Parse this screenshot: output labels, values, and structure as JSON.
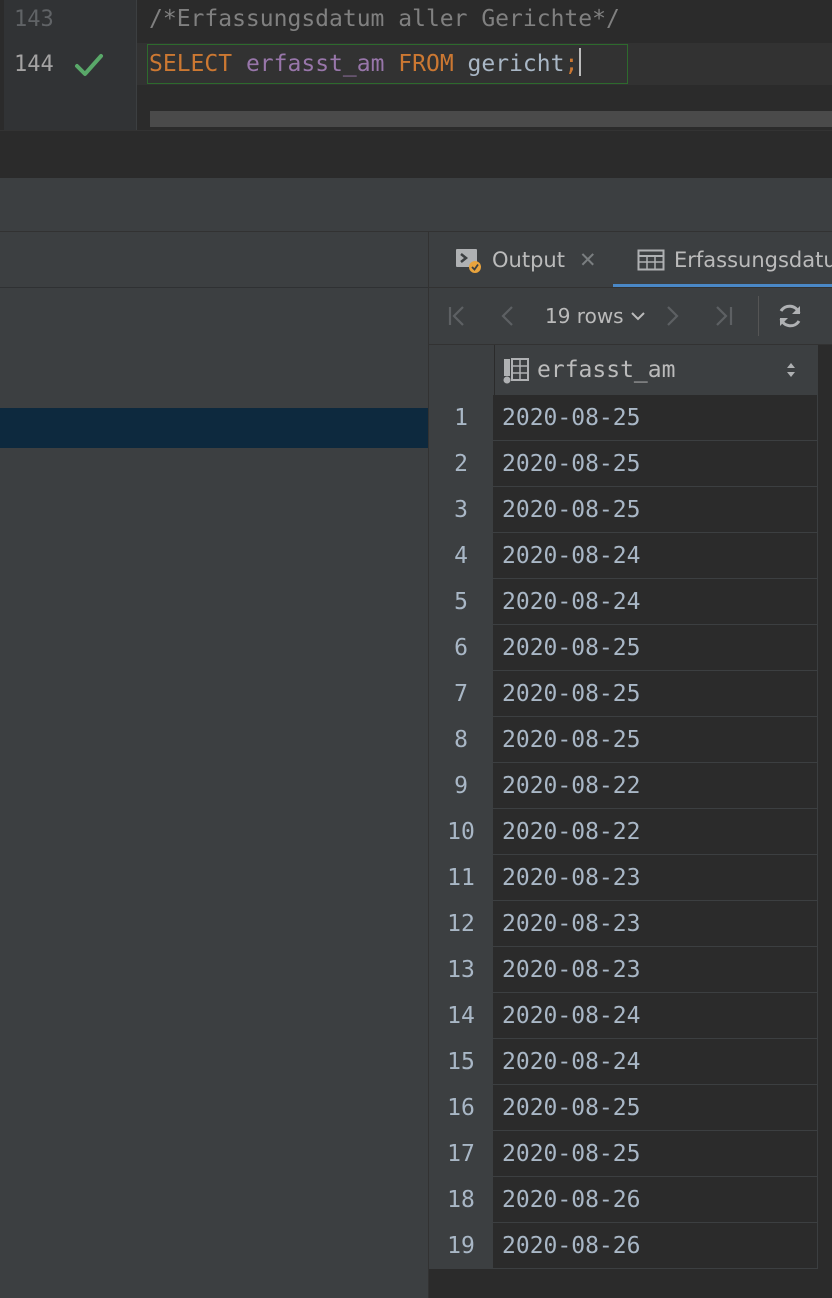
{
  "editor": {
    "line_numbers": [
      "143",
      "144"
    ],
    "comment": "/*Erfassungsdatum aller Gerichte*/",
    "statement": {
      "kw_select": "SELECT",
      "column": "erfasst_am",
      "kw_from": "FROM",
      "table": "gericht",
      "semicolon": ";"
    }
  },
  "tabs": [
    {
      "label": "Output",
      "icon": "console-output-icon"
    },
    {
      "label": "Erfassungsdatum",
      "icon": "table-grid-icon"
    }
  ],
  "toolbar": {
    "row_count": "19 rows"
  },
  "grid": {
    "column_header": "erfasst_am",
    "rows": [
      {
        "n": "1",
        "v": "2020-08-25"
      },
      {
        "n": "2",
        "v": "2020-08-25"
      },
      {
        "n": "3",
        "v": "2020-08-25"
      },
      {
        "n": "4",
        "v": "2020-08-24"
      },
      {
        "n": "5",
        "v": "2020-08-24"
      },
      {
        "n": "6",
        "v": "2020-08-25"
      },
      {
        "n": "7",
        "v": "2020-08-25"
      },
      {
        "n": "8",
        "v": "2020-08-25"
      },
      {
        "n": "9",
        "v": "2020-08-22"
      },
      {
        "n": "10",
        "v": "2020-08-22"
      },
      {
        "n": "11",
        "v": "2020-08-23"
      },
      {
        "n": "12",
        "v": "2020-08-23"
      },
      {
        "n": "13",
        "v": "2020-08-23"
      },
      {
        "n": "14",
        "v": "2020-08-24"
      },
      {
        "n": "15",
        "v": "2020-08-24"
      },
      {
        "n": "16",
        "v": "2020-08-25"
      },
      {
        "n": "17",
        "v": "2020-08-25"
      },
      {
        "n": "18",
        "v": "2020-08-26"
      },
      {
        "n": "19",
        "v": "2020-08-26"
      }
    ]
  },
  "colors": {
    "keyword": "#cc7832",
    "column": "#9876aa",
    "accent": "#4a88c7",
    "success": "#59a869"
  }
}
